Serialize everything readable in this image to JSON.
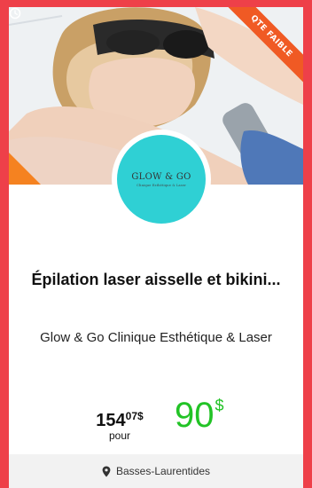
{
  "badge": {
    "text": "QTE FAIBLE"
  },
  "logo": {
    "name": "GLOW & GO",
    "tagline": "Clinique Esthétique & Laser"
  },
  "offer": {
    "title": "Épilation laser aisselle et bikini...",
    "merchant": "Glow & Go Clinique Esthétique & Laser"
  },
  "pricing": {
    "old_main": "154",
    "old_cents": "07$",
    "pour": "pour",
    "new_main": "90",
    "new_currency": "$"
  },
  "location": {
    "label": "Basses-Laurentides"
  },
  "colors": {
    "background": "#ee4049",
    "accent_green": "#22c326",
    "ribbon": "#f05a24",
    "logo_bg": "#2fd0d4"
  },
  "icons": [
    "clock-icon",
    "location-pin-icon"
  ]
}
